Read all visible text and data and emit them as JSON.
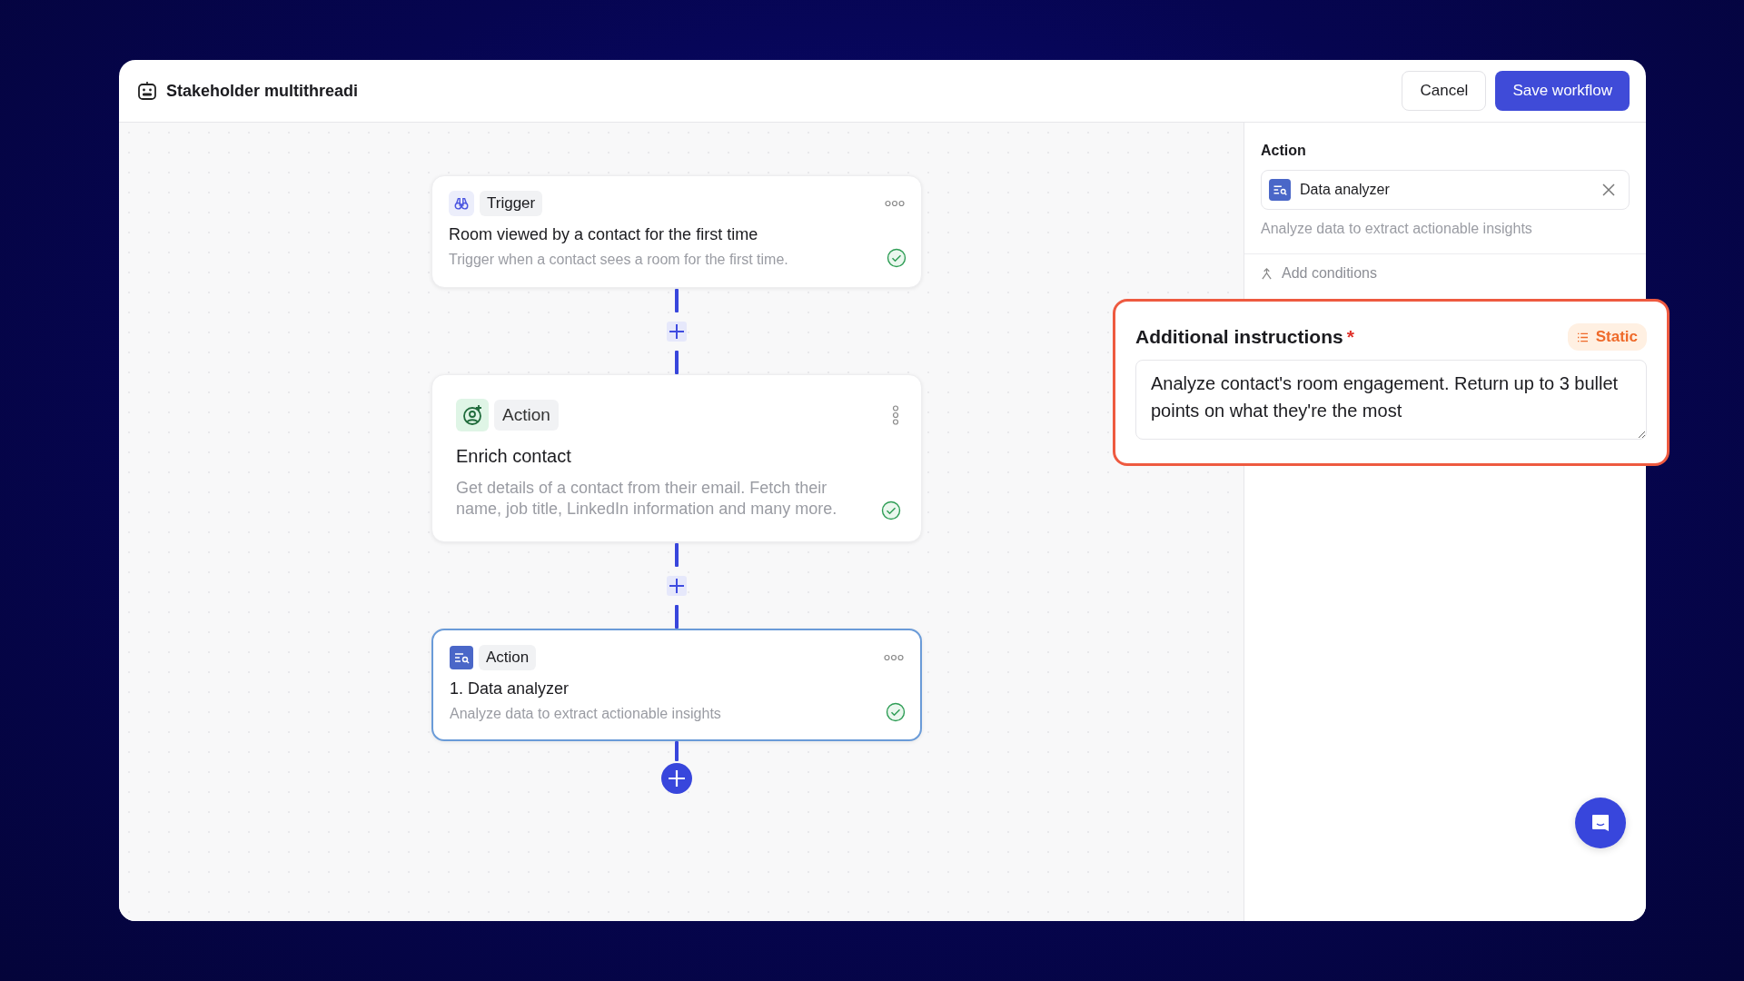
{
  "header": {
    "title": "Stakeholder multithreadi",
    "buttons": [
      {
        "label": "Cancel",
        "kind": "secondary"
      },
      {
        "label": "Save workflow",
        "kind": "primary"
      }
    ]
  },
  "nodes": [
    {
      "kind": "trigger",
      "badge": "Trigger",
      "title": "Room viewed by a contact for the first time",
      "description": "Trigger when a contact sees a room for the first time.",
      "complete": true,
      "selected": false
    },
    {
      "kind": "enrich",
      "badge": "Action",
      "title": "Enrich contact",
      "description": "Get details of a contact from their email. Fetch their name, job title, LinkedIn information and many more.",
      "complete": true,
      "selected": false
    },
    {
      "kind": "analyzer",
      "badge": "Action",
      "title": "1. Data analyzer",
      "description": "Analyze data to extract actionable insights",
      "complete": true,
      "selected": true
    }
  ],
  "panel": {
    "section_label": "Action",
    "action": "Data analyzer",
    "action_description": "Analyze data to extract actionable insights",
    "add_conditions": "Add conditions"
  },
  "highlight": {
    "label": "Additional instructions",
    "required_mark": "*",
    "mode": "Static",
    "value": "Analyze contact's room engagement. Return up to 3 bullet points on what they're the most"
  }
}
